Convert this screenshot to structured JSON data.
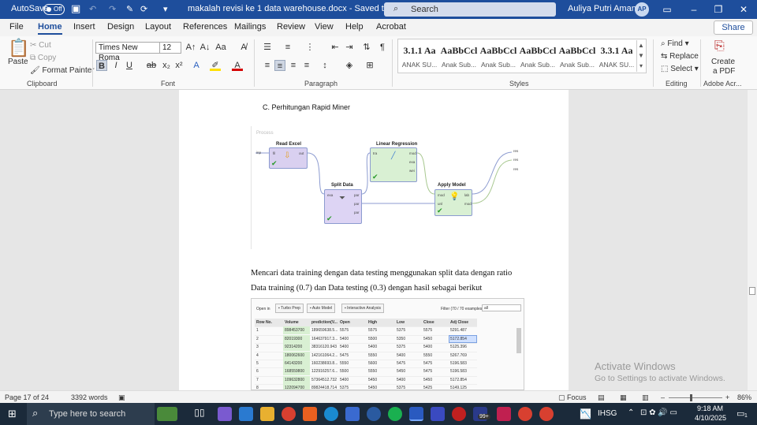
{
  "titlebar": {
    "autosave": "AutoSave",
    "toggle": "Off",
    "doc_title": "makalah revisi ke 1 data warehouse.docx  -  Saved to this PC",
    "search": "Search",
    "user": "Auliya Putri Amanda",
    "initials": "AP"
  },
  "menu": [
    "File",
    "Home",
    "Insert",
    "Design",
    "Layout",
    "References",
    "Mailings",
    "Review",
    "View",
    "Help",
    "Acrobat"
  ],
  "share": "Share",
  "clipboard": {
    "paste": "Paste",
    "cut": "Cut",
    "copy": "Copy",
    "format_painter": "Format Painter",
    "group": "Clipboard"
  },
  "font": {
    "name": "Times New Roma",
    "size": "12",
    "group": "Font"
  },
  "paragraph": {
    "group": "Paragraph"
  },
  "styles": {
    "group": "Styles",
    "items": [
      {
        "sample": "3.1.1  Aa",
        "name": "ANAK SU..."
      },
      {
        "sample": "AaBbCcl",
        "name": "Anak Sub..."
      },
      {
        "sample": "AaBbCcl",
        "name": "Anak Sub..."
      },
      {
        "sample": "AaBbCcl",
        "name": "Anak Sub..."
      },
      {
        "sample": "AaBbCcl",
        "name": "Anak Sub..."
      },
      {
        "sample": "3.3.1  Aa",
        "name": "ANAK SU..."
      }
    ]
  },
  "editing": {
    "find": "Find",
    "replace": "Replace",
    "select": "Select",
    "group": "Editing"
  },
  "adobe": {
    "create": "Create",
    "pdf": "a PDF",
    "group": "Adobe Acr..."
  },
  "document": {
    "heading": "C.    Perhitungan Rapid Miner",
    "process_label": "Process",
    "operators": {
      "read_excel": "Read Excel",
      "split_data": "Split Data",
      "linear_regression": "Linear Regression",
      "apply_model": "Apply Model"
    },
    "ports": {
      "inp": "inp",
      "fil": "fil",
      "out": "out",
      "exa": "exa",
      "par": "par",
      "tra": "tra",
      "mod": "mod",
      "wei": "wei",
      "unl": "unl",
      "lab": "lab",
      "res": "res"
    },
    "para1": "Mencari data training dengan data testing menggunakan split data dengan ratio",
    "para2": "Data training (0.7) dan Data testing (0.3) dengan hasil sebagai berikut"
  },
  "results_table": {
    "open_in": "Open in",
    "buttons": [
      "Turbo Prep",
      "Auto Model",
      "Interactive Analysis"
    ],
    "filter": "Filter (70 / 70 examples):",
    "filter_value": "all",
    "columns": [
      "Row No.",
      "Volume",
      "prediction(V...",
      "Open",
      "High",
      "Low",
      "Close",
      "Adj Close"
    ],
    "rows": [
      [
        "1",
        "898453700",
        "189659638.5...",
        "5575",
        "5575",
        "5375",
        "5575",
        "5291.487"
      ],
      [
        "2",
        "82019300",
        "164637917.3...",
        "5400",
        "5500",
        "5350",
        "5450",
        "5172.854"
      ],
      [
        "3",
        "92314200",
        "38316120.943",
        "5400",
        "5400",
        "5375",
        "5400",
        "5125.396"
      ],
      [
        "4",
        "180062600",
        "142161064.2...",
        "5475",
        "5550",
        "5400",
        "5550",
        "5267.769"
      ],
      [
        "5",
        "64143200",
        "160238693.8...",
        "5550",
        "5600",
        "5475",
        "5475",
        "5196.583"
      ],
      [
        "6",
        "168559800",
        "122916257.6...",
        "5500",
        "5550",
        "5450",
        "5475",
        "5196.583"
      ],
      [
        "7",
        "109632800",
        "57364512.732",
        "5400",
        "5450",
        "5400",
        "5450",
        "5172.854"
      ],
      [
        "8",
        "122094700",
        "89824418.714",
        "5375",
        "5450",
        "5375",
        "5425",
        "5149.125"
      ]
    ]
  },
  "watermark": {
    "line1": "Activate Windows",
    "line2": "Go to Settings to activate Windows."
  },
  "status": {
    "page": "Page 17 of 24",
    "words": "3392 words",
    "focus": "Focus",
    "zoom": "86%"
  },
  "taskbar": {
    "search": "Type here to search",
    "badge": "99+",
    "ticker": "IHSG",
    "time": "9:18 AM",
    "date": "4/10/2025",
    "notif": "1"
  },
  "colors": {
    "titlebar": "#1e4e9c",
    "op_green": "#d9f0d3",
    "op_purple": "#d9d0f0",
    "highlight": "#cfe0ff"
  }
}
